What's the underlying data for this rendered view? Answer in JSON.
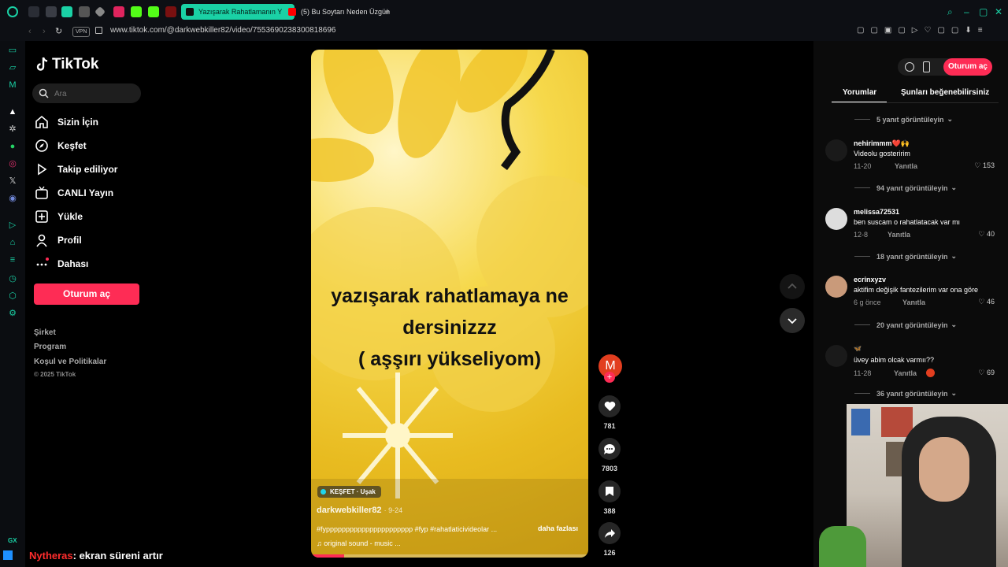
{
  "browser": {
    "tabs": [
      {
        "label": "Yazışarak Rahatlamanın Y",
        "active": true
      },
      {
        "label": "(5) Bu Soytarı Neden Üzgün",
        "active": false
      }
    ],
    "new_tab": "+",
    "vpn_badge": "VPN",
    "url": "www.tiktok.com/@darkwebkiller82/video/7553690238300818696",
    "gx_label": "GX",
    "accent_color": "#1ad1a5"
  },
  "tiktok": {
    "logo_text": "TikTok",
    "search_placeholder": "Ara",
    "nav": [
      {
        "label": "Sizin İçin",
        "icon": "home-icon"
      },
      {
        "label": "Keşfet",
        "icon": "compass-icon"
      },
      {
        "label": "Takip ediliyor",
        "icon": "following-icon"
      },
      {
        "label": "CANLI Yayın",
        "icon": "live-icon"
      },
      {
        "label": "Yükle",
        "icon": "upload-icon"
      },
      {
        "label": "Profil",
        "icon": "profile-icon"
      },
      {
        "label": "Dahası",
        "icon": "more-icon"
      }
    ],
    "login_button": "Oturum aç",
    "footer_links": [
      "Şirket",
      "Program",
      "Koşul ve Politikalar"
    ],
    "copyright": "© 2025 TikTok",
    "brand_color": "#fe2c55"
  },
  "video": {
    "caption_lines": [
      "yazışarak rahatlamaya ne",
      "dersinizzz",
      "( aşşırı yükseliyom)"
    ],
    "location_tag": "KEŞFET · Uşak",
    "author": "darkwebkiller82",
    "date": "· 9-24",
    "hashtags": "#fypppppppppppppppppppppp #fyp #rahatlaticivideolar ...",
    "more_label": "daha fazlası",
    "music": "original sound - music ...",
    "avatar_letter": "M"
  },
  "actions": {
    "likes": "781",
    "comments": "7803",
    "saves": "388",
    "shares": "126"
  },
  "right_panel": {
    "login_button": "Oturum aç",
    "tabs": [
      "Yorumlar",
      "Şunları beğenebilirsiniz"
    ],
    "view_replies": [
      "5 yanıt görüntüleyin",
      "94 yanıt görüntüleyin",
      "18 yanıt görüntüleyin",
      "20 yanıt görüntüleyin",
      "36 yanıt görüntüleyin"
    ],
    "reply_label": "Yanıtla",
    "comments": [
      {
        "user": "nehirimmm❤️🙌",
        "text": "Videolu gosteririm",
        "date": "11-20",
        "likes": "153"
      },
      {
        "user": "melissa72531",
        "text": "ben suscam o rahatlatacak var mı",
        "date": "12-8",
        "likes": "40"
      },
      {
        "user": "ecrinxyzv",
        "text": "aktifim değişik fantezilerim var ona göre",
        "date": "6 g önce",
        "likes": "46"
      },
      {
        "user": "🦋",
        "text": "üvey abim olcak varmıı??",
        "date": "11-28",
        "likes": "69"
      }
    ]
  },
  "stream_overlay": {
    "chat_user": "Nytheras",
    "chat_message": ": ekran süreni artır"
  }
}
